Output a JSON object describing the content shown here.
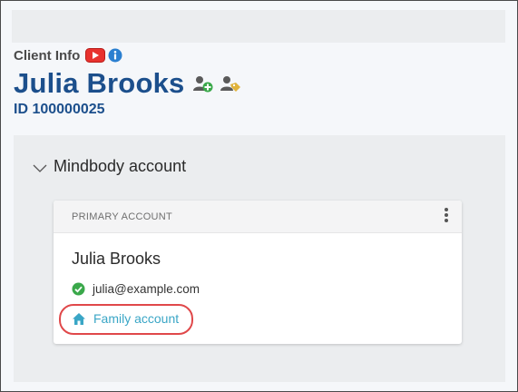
{
  "header": {
    "section_label": "Client Info",
    "client_name": "Julia Brooks",
    "client_id": "ID 100000025"
  },
  "icons": {
    "video": "youtube-icon",
    "info": "info-icon",
    "add_person": "add-person-icon",
    "tag_person": "tag-person-icon",
    "collapse": "chevron-down-icon",
    "menu": "kebab-menu-icon",
    "verified": "check-circle-icon",
    "family": "home-icon"
  },
  "account_section": {
    "title": "Mindbody account",
    "card": {
      "label": "PRIMARY ACCOUNT",
      "name": "Julia Brooks",
      "email": "julia@example.com",
      "family_link": "Family account"
    }
  },
  "colors": {
    "brand_blue": "#1c4f8c",
    "link_teal": "#3aa6c6",
    "verified_green": "#3aa84a",
    "highlight_red": "#e0484a"
  }
}
